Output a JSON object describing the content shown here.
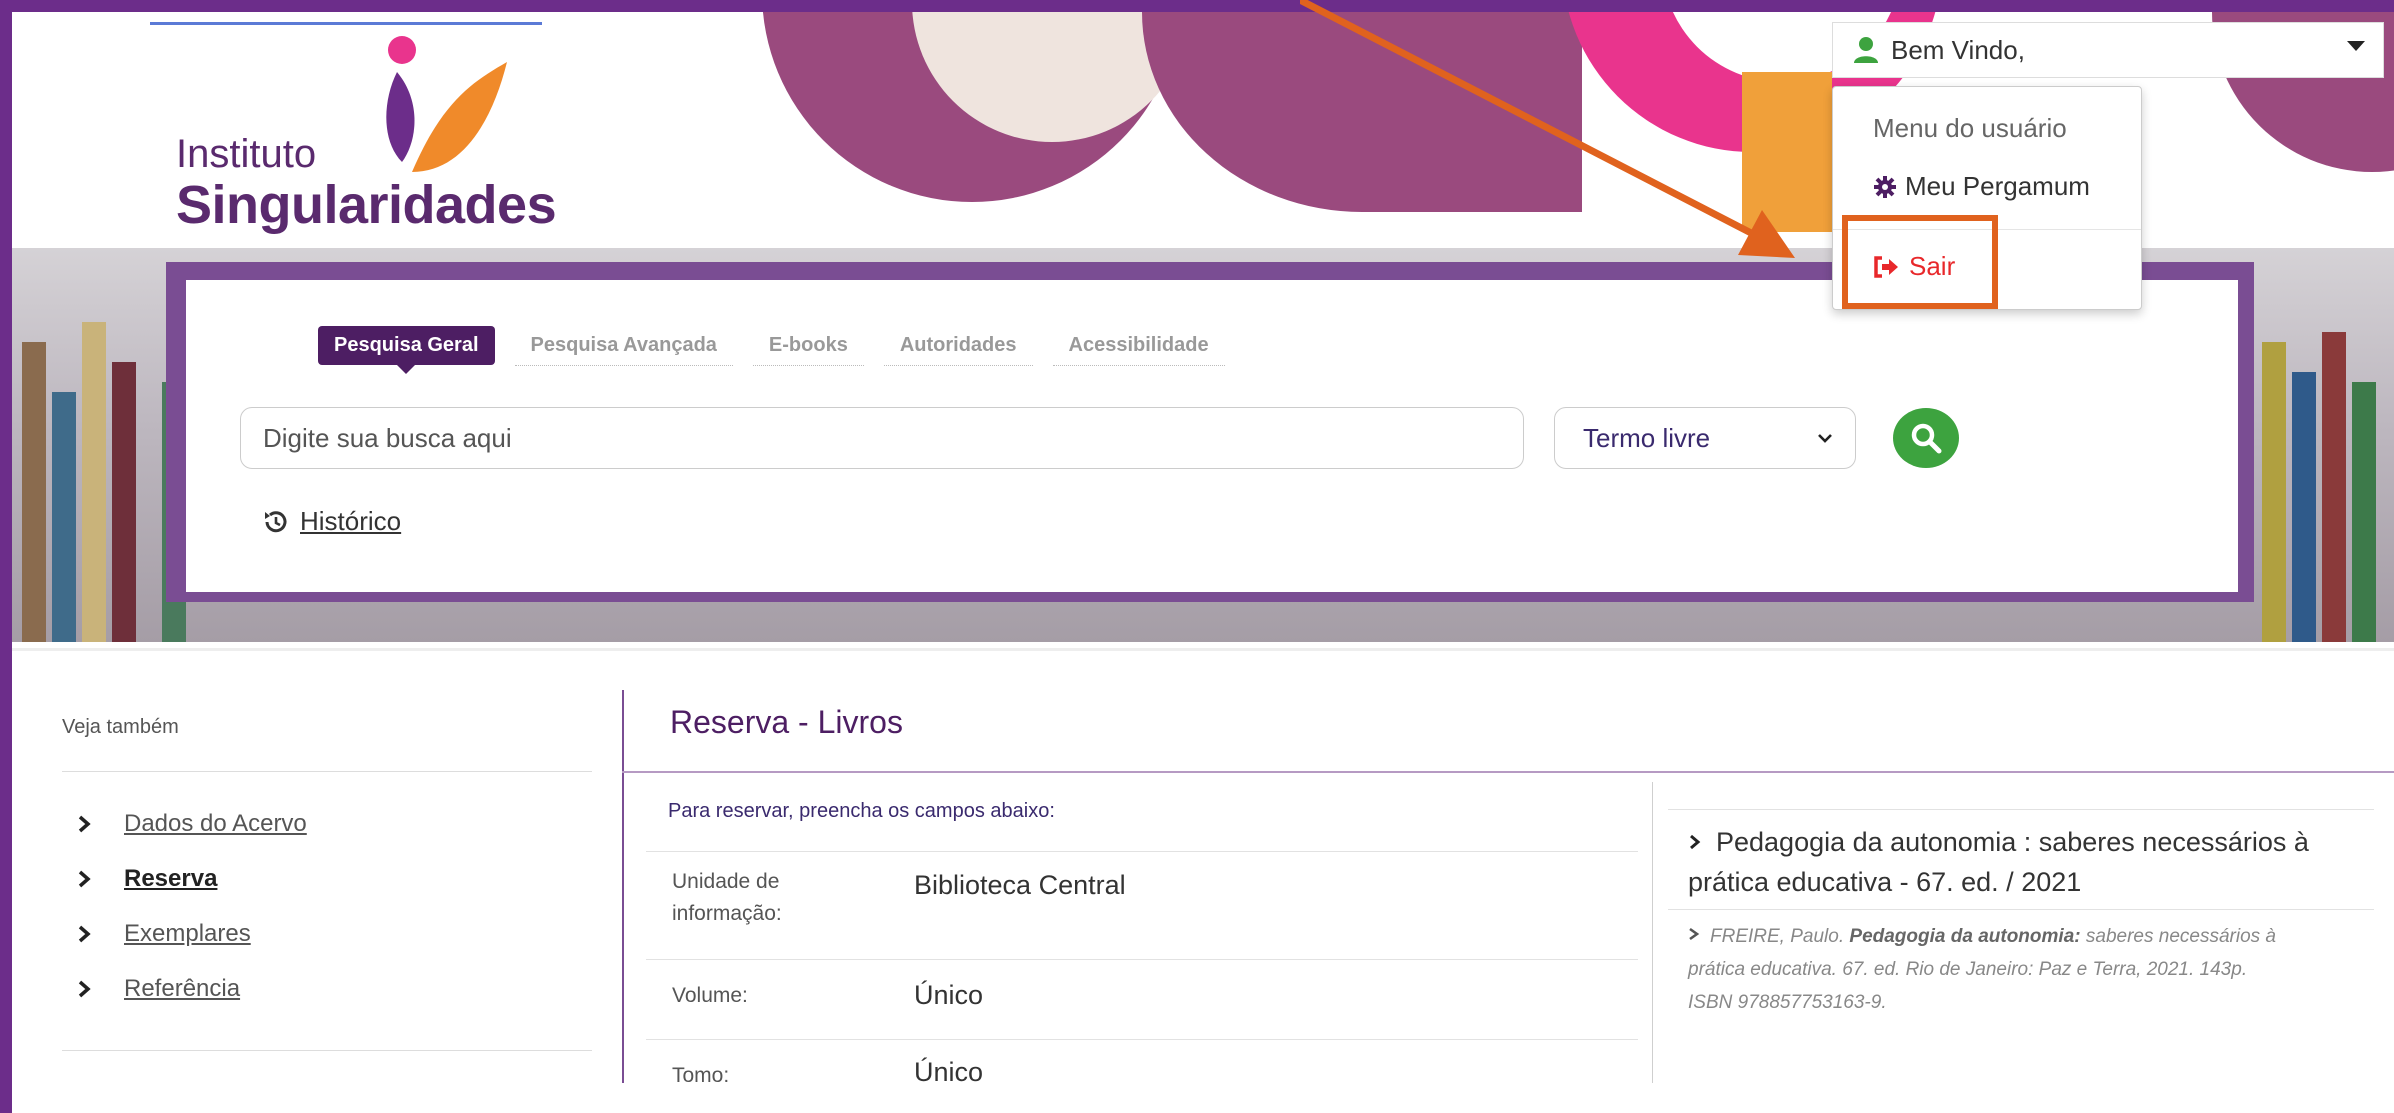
{
  "logo": {
    "line1": "Instituto",
    "line2": "Singularidades"
  },
  "user_menu": {
    "greeting": "Bem Vindo,",
    "header": "Menu do usuário",
    "items": [
      {
        "label": "Meu Pergamum",
        "icon": "gear-icon"
      },
      {
        "label": "Sair",
        "icon": "sign-out-icon"
      }
    ]
  },
  "search": {
    "tabs": [
      "Pesquisa Geral",
      "Pesquisa Avançada",
      "E-books",
      "Autoridades",
      "Acessibilidade"
    ],
    "active_tab": "Pesquisa Geral",
    "placeholder": "Digite sua busca aqui",
    "type_select": "Termo livre",
    "history_label": "Histórico"
  },
  "sidebar": {
    "title": "Veja também",
    "items": [
      {
        "label": "Dados do Acervo"
      },
      {
        "label": "Reserva"
      },
      {
        "label": "Exemplares"
      },
      {
        "label": "Referência"
      }
    ]
  },
  "main": {
    "title": "Reserva - Livros",
    "intro": "Para reservar, preencha os campos abaixo:",
    "fields": [
      {
        "label": "Unidade de informação:",
        "value": "Biblioteca Central"
      },
      {
        "label": "Volume:",
        "value": "Único"
      },
      {
        "label": "Tomo:",
        "value": "Único"
      }
    ]
  },
  "reference": {
    "title": "Pedagogia da autonomia : saberes necessários à prática educativa - 67. ed. / 2021",
    "cite_author": "FREIRE, Paulo.",
    "cite_title": "Pedagogia da autonomia:",
    "cite_rest": "saberes necessários à prática educativa. 67. ed. Rio de Janeiro: Paz e Terra, 2021. 143p. ISBN 978857753163-9."
  },
  "colors": {
    "brand_purple": "#6c2d8a",
    "dark_purple": "#4d1e63",
    "search_green": "#3da33f",
    "sair_red": "#e8282b",
    "annotation_orange": "#e0621e"
  }
}
